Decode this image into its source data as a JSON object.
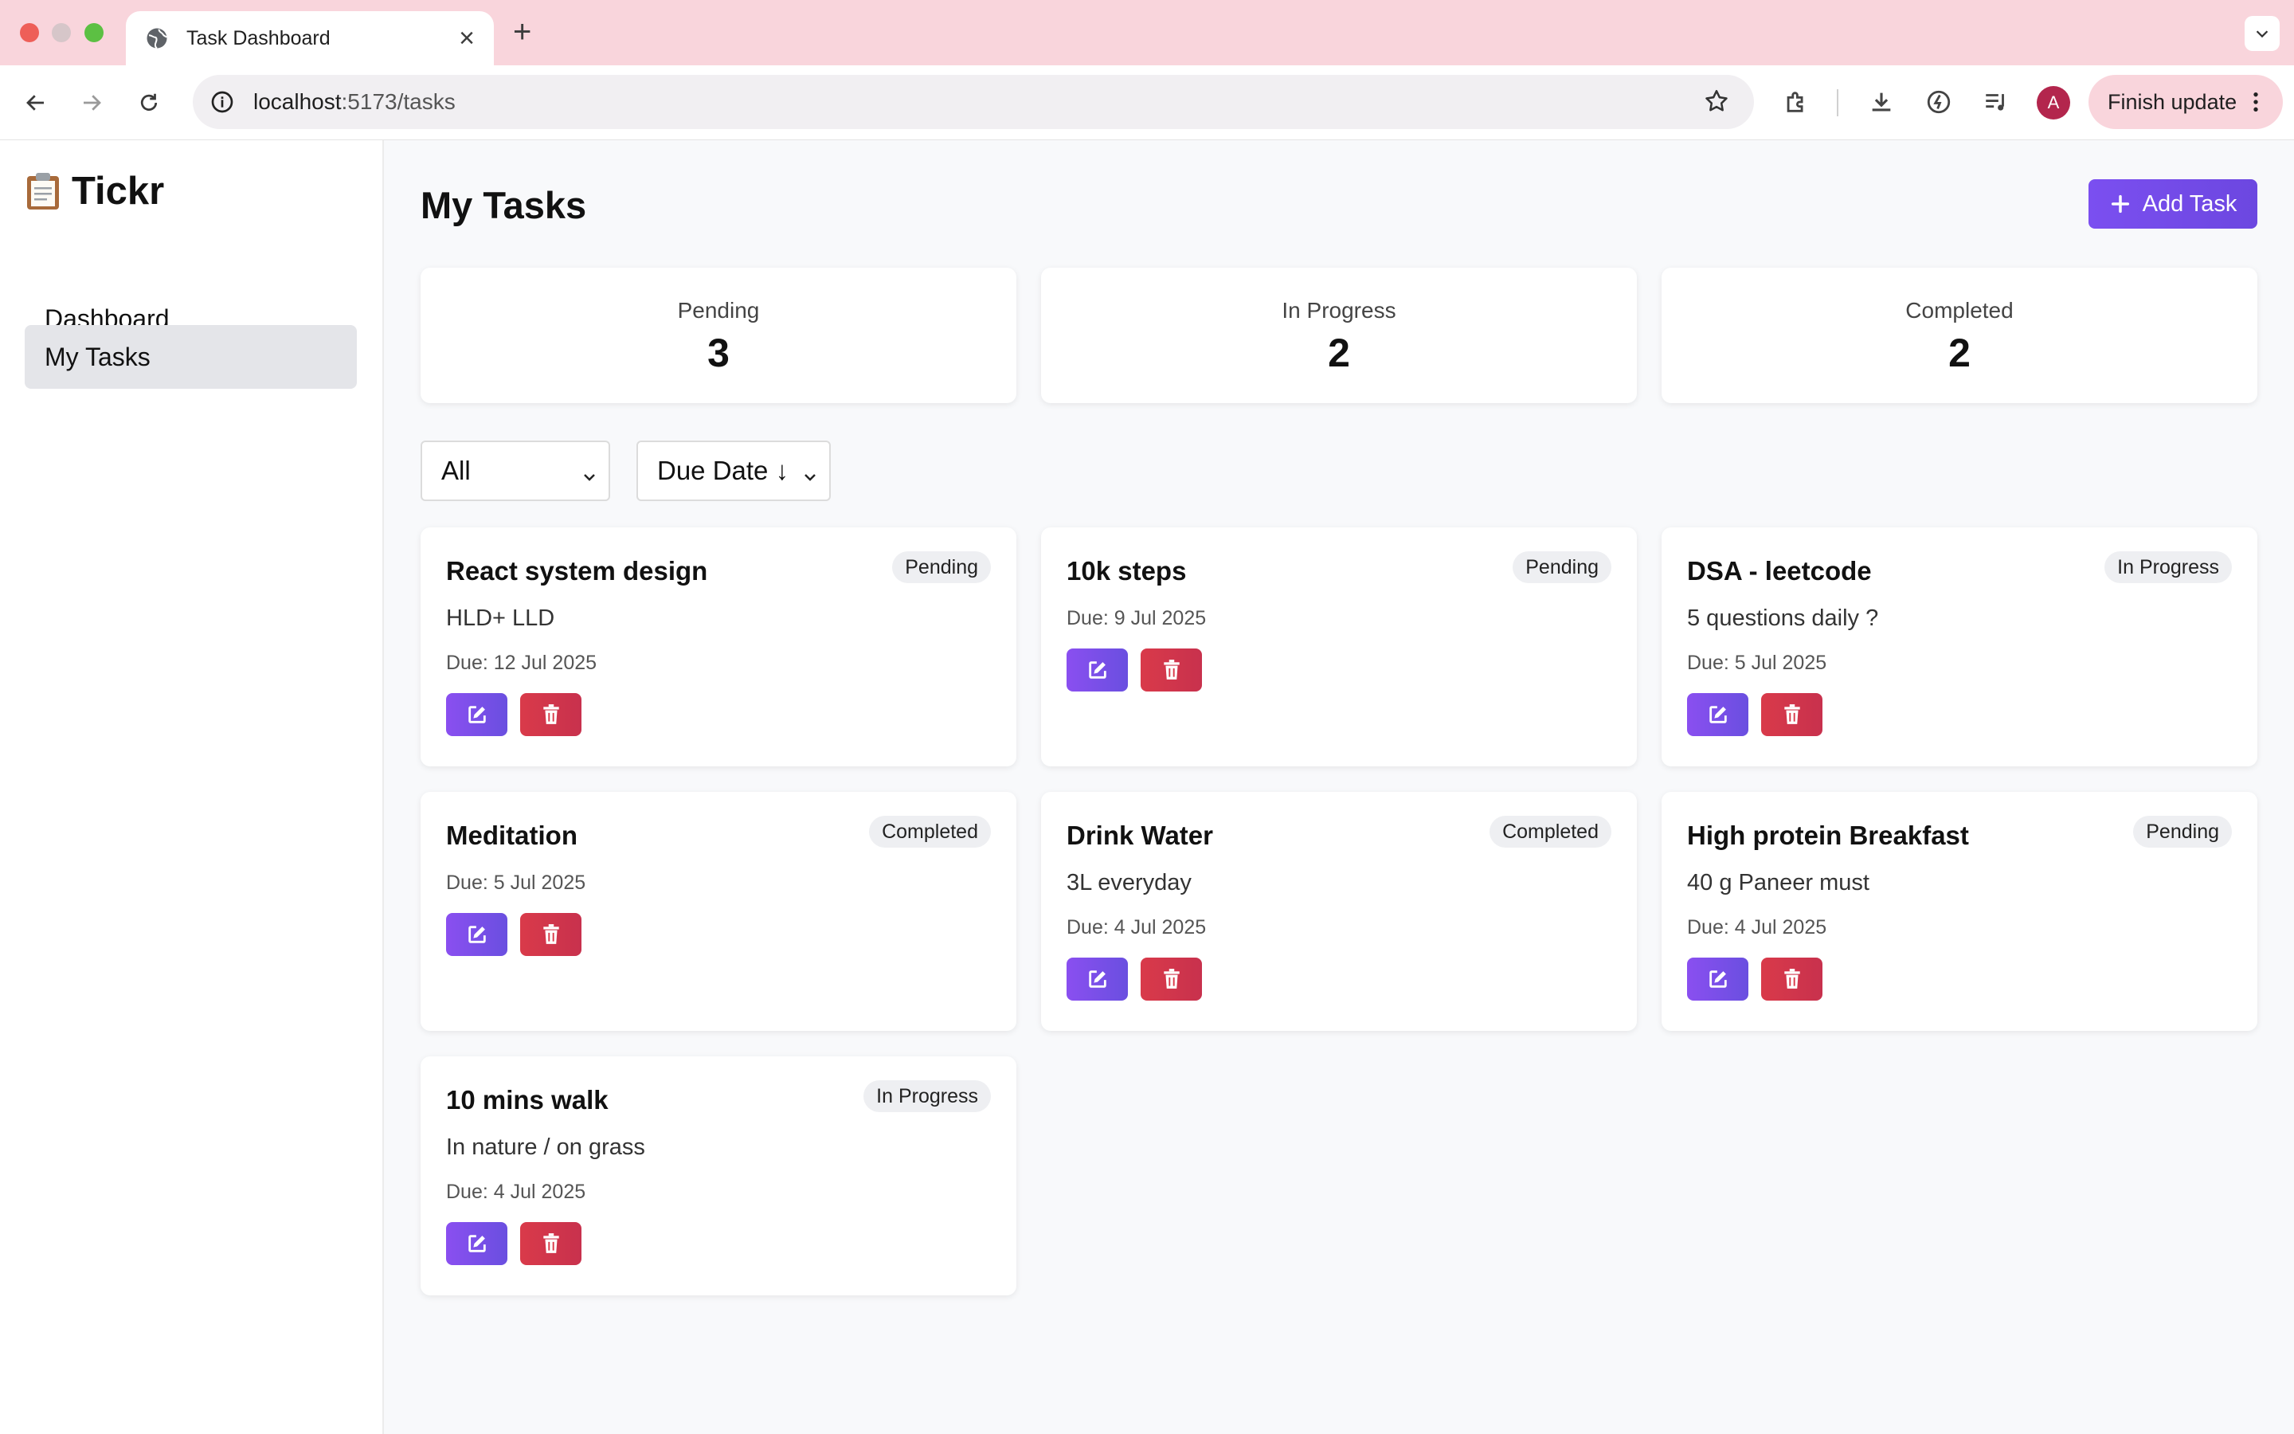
{
  "browser": {
    "tab_title": "Task Dashboard",
    "url_host": "localhost",
    "url_rest": ":5173/tasks",
    "profile_initial": "A",
    "finish_update_label": "Finish update"
  },
  "app": {
    "brand": "Tickr",
    "nav": [
      {
        "label": "Dashboard",
        "active": false
      },
      {
        "label": "My Tasks",
        "active": true
      }
    ]
  },
  "page": {
    "title": "My Tasks",
    "add_button_label": "Add Task"
  },
  "stats": [
    {
      "label": "Pending",
      "count": "3"
    },
    {
      "label": "In Progress",
      "count": "2"
    },
    {
      "label": "Completed",
      "count": "2"
    }
  ],
  "filters": {
    "status_value": "All",
    "sort_value": "Due Date ↓"
  },
  "tasks": [
    {
      "title": "React system design",
      "status": "Pending",
      "description": "HLD+ LLD",
      "due": "Due: 12 Jul 2025"
    },
    {
      "title": "10k steps",
      "status": "Pending",
      "description": "",
      "due": "Due: 9 Jul 2025"
    },
    {
      "title": "DSA - leetcode",
      "status": "In Progress",
      "description": "5 questions daily ?",
      "due": "Due: 5 Jul 2025"
    },
    {
      "title": "Meditation",
      "status": "Completed",
      "description": "",
      "due": "Due: 5 Jul 2025"
    },
    {
      "title": "Drink Water",
      "status": "Completed",
      "description": "3L everyday",
      "due": "Due: 4 Jul 2025"
    },
    {
      "title": "High protein Breakfast",
      "status": "Pending",
      "description": "40 g Paneer must",
      "due": "Due: 4 Jul 2025"
    },
    {
      "title": "10 mins walk",
      "status": "In Progress",
      "description": "In nature / on grass",
      "due": "Due: 4 Jul 2025"
    }
  ],
  "colors": {
    "accent": "#7b4ff0",
    "danger": "#d93a4a",
    "tabstrip": "#f9d5dc"
  },
  "icons": {
    "brand": "clipboard-icon",
    "add": "plus-icon",
    "edit": "edit-icon",
    "delete": "trash-icon"
  }
}
